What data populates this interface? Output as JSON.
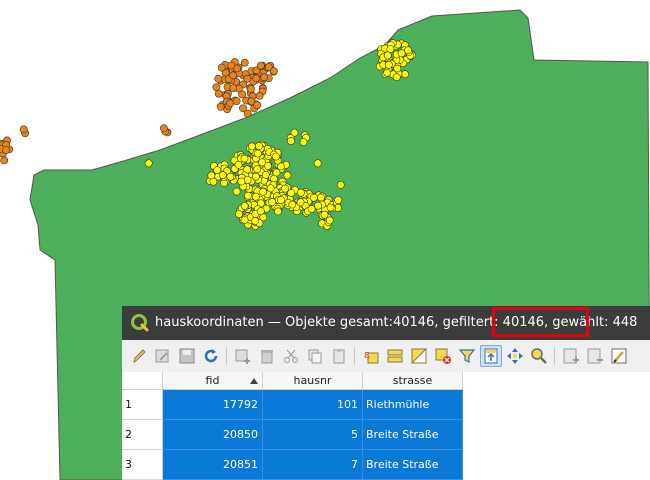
{
  "map": {
    "colors": {
      "polygon": "#4daf5b",
      "polygon_stroke": "#555555",
      "selected_points": "#ffff00",
      "other_points": "#e8841a",
      "point_stroke": "#333333"
    }
  },
  "attribute_table": {
    "title": "hauskoordinaten — Objekte gesamt:40146, gefiltert: 40146, gewählt: 448",
    "highlighted_text": "gewählt: 448",
    "toolbar": {
      "buttons": [
        "pencil-icon",
        "multi-edit-icon",
        "save-icon",
        "reload-icon",
        "add-feature-icon",
        "delete-icon",
        "cut-icon",
        "copy-icon",
        "paste-icon",
        "select-by-expression-icon",
        "select-all-icon",
        "invert-selection-icon",
        "deselect-icon",
        "filter-icon",
        "move-selection-to-top-icon",
        "pan-to-selected-icon",
        "zoom-to-selected-icon",
        "new-field-icon",
        "delete-field-icon",
        "field-calculator-icon"
      ],
      "active_button": "move-selection-to-top-icon"
    },
    "columns": [
      "fid",
      "hausnr",
      "strasse"
    ],
    "sort_column": "fid",
    "rows": [
      {
        "num": "1",
        "fid": "17792",
        "hausnr": "101",
        "strasse": "Riethmühle"
      },
      {
        "num": "2",
        "fid": "20850",
        "hausnr": "5",
        "strasse": "Breite Straße"
      },
      {
        "num": "3",
        "fid": "20851",
        "hausnr": "7",
        "strasse": "Breite Straße"
      }
    ],
    "selection_color": "#0a78d7"
  }
}
